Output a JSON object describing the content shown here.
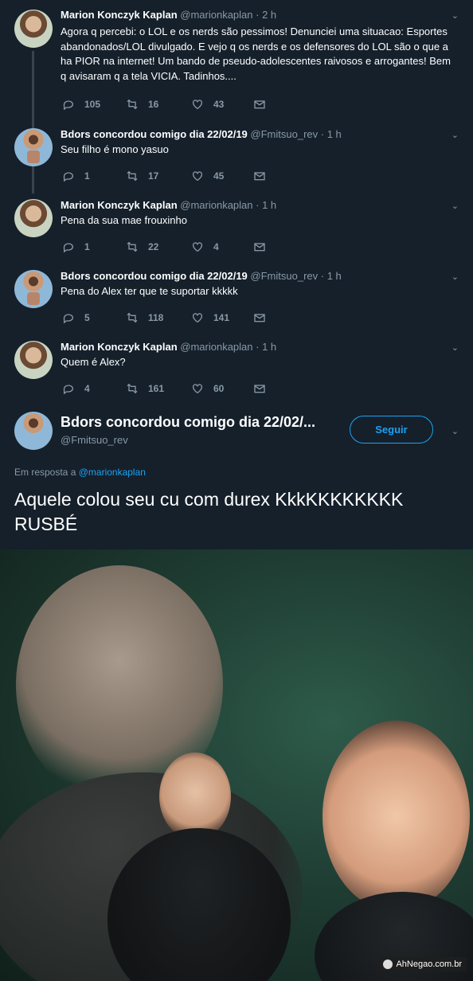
{
  "thread": [
    {
      "name": "Marion Konczyk Kaplan",
      "handle": "@marionkaplan",
      "time": "· 2 h",
      "text": "Agora q percebi: o LOL e os nerds são pessimos! Denunciei uma situacao: Esportes abandonados/LOL divulgado. E vejo q os nerds e os defensores do LOL são o que a ha PIOR na internet! Um bando de pseudo-adolescentes raivosos e arrogantes! Bem q avisaram q a tela VICIA. Tadinhos....",
      "replies": "105",
      "retweets": "16",
      "likes": "43"
    },
    {
      "name": "Bdors concordou comigo dia 22/02/19",
      "handle": "@Fmitsuo_rev",
      "time": "· 1 h",
      "text": "Seu filho é mono yasuo",
      "replies": "1",
      "retweets": "17",
      "likes": "45"
    },
    {
      "name": "Marion Konczyk Kaplan",
      "handle": "@marionkaplan",
      "time": "· 1 h",
      "text": "Pena da sua mae frouxinho",
      "replies": "1",
      "retweets": "22",
      "likes": "4"
    },
    {
      "name": "Bdors concordou comigo dia 22/02/19",
      "handle": "@Fmitsuo_rev",
      "time": "· 1 h",
      "text": "Pena do Alex ter que te suportar kkkkk",
      "replies": "5",
      "retweets": "118",
      "likes": "141"
    },
    {
      "name": "Marion Konczyk Kaplan",
      "handle": "@marionkaplan",
      "time": "· 1 h",
      "text": "Quem é Alex?",
      "replies": "4",
      "retweets": "161",
      "likes": "60"
    }
  ],
  "main": {
    "name": "Bdors concordou comigo dia 22/02/...",
    "handle": "@Fmitsuo_rev",
    "follow_label": "Seguir",
    "reply_prefix": "Em resposta a",
    "reply_to": "@marionkaplan",
    "text": "Aquele colou seu cu com durex KkkKKKKKKKK RUSBÉ"
  },
  "watermark": "AhNegao.com.br",
  "colors": {
    "background": "#15202b",
    "accent": "#1da1f2",
    "muted": "#8899a6"
  }
}
